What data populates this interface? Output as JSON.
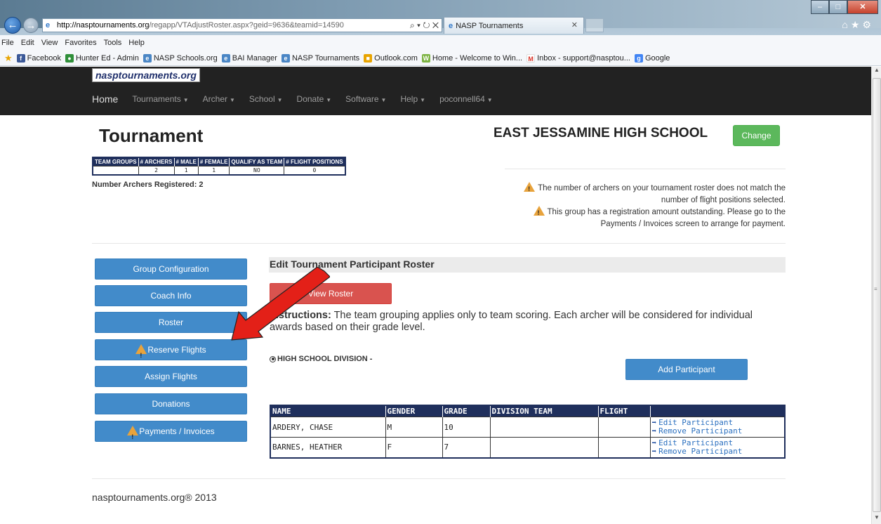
{
  "browser": {
    "url_domain": "http://nasptournaments.org",
    "url_rest": "/regapp/VTAdjustRoster.aspx?geid=9636&teamid=14590",
    "address_tools": "⌕ ▾ ↻ ✕",
    "tab_title": "NASP Tournaments",
    "menu": [
      "File",
      "Edit",
      "View",
      "Favorites",
      "Tools",
      "Help"
    ],
    "favorites": [
      {
        "label": "Facebook",
        "color": "#3b5998",
        "glyph": "f"
      },
      {
        "label": "Hunter Ed - Admin",
        "color": "#2f8f3a",
        "glyph": "●"
      },
      {
        "label": "NASP Schools.org",
        "color": "#4a86c5",
        "glyph": "e"
      },
      {
        "label": "BAI Manager",
        "color": "#4a86c5",
        "glyph": "e"
      },
      {
        "label": "NASP Tournaments",
        "color": "#4a86c5",
        "glyph": "e"
      },
      {
        "label": "Outlook.com",
        "color": "#e8a400",
        "glyph": "■"
      },
      {
        "label": "Home - Welcome to Win...",
        "color": "#7cb342",
        "glyph": "W"
      },
      {
        "label": "Inbox - support@nasptou...",
        "color": "#d93025",
        "glyph": "M"
      },
      {
        "label": "Google",
        "color": "#4285f4",
        "glyph": "g"
      }
    ]
  },
  "site": {
    "logo": "nasptournaments.org",
    "nav": [
      {
        "label": "Home",
        "caret": false
      },
      {
        "label": "Tournaments",
        "caret": true
      },
      {
        "label": "Archer",
        "caret": true
      },
      {
        "label": "School",
        "caret": true
      },
      {
        "label": "Donate",
        "caret": true
      },
      {
        "label": "Software",
        "caret": true
      },
      {
        "label": "Help",
        "caret": true
      },
      {
        "label": "poconnell64",
        "caret": true
      }
    ]
  },
  "header": {
    "title": "Tournament",
    "school": "EAST JESSAMINE HIGH SCHOOL",
    "change_label": "Change"
  },
  "summary": {
    "headers": [
      "TEAM GROUPS",
      "# ARCHERS",
      "# MALE",
      "# FEMALE",
      "QUALIFY AS TEAM",
      "# FLIGHT POSITIONS"
    ],
    "row": [
      "",
      "2",
      "1",
      "1",
      "NO",
      "0"
    ],
    "registered": "Number Archers Registered: 2"
  },
  "warnings": [
    "The number of archers on your tournament roster does not match the number of flight positions selected.",
    "This group has a registration amount outstanding. Please go to the Payments / Invoices screen to arrange for payment."
  ],
  "sidebar": [
    {
      "label": "Group Configuration",
      "warn": false
    },
    {
      "label": "Coach Info",
      "warn": false
    },
    {
      "label": "Roster",
      "warn": false
    },
    {
      "label": "Reserve Flights",
      "warn": true
    },
    {
      "label": "Assign Flights",
      "warn": false
    },
    {
      "label": "Donations",
      "warn": false
    },
    {
      "label": "Payments / Invoices",
      "warn": true
    }
  ],
  "main": {
    "section_title": "Edit Tournament Participant Roster",
    "view_roster_label": "View Roster",
    "instructions_bold": "Instructions:",
    "instructions_text": " The team grouping applies only to team scoring. Each archer will be considered for individual awards based on their grade level.",
    "division": "HIGH SCHOOL DIVISION -",
    "add_participant_label": "Add Participant"
  },
  "roster": {
    "headers": [
      "NAME",
      "GENDER",
      "GRADE",
      "DIVISION TEAM",
      "FLIGHT",
      ""
    ],
    "rows": [
      {
        "name": "ARDERY, CHASE",
        "gender": "M",
        "grade": "10",
        "team": "",
        "flight": ""
      },
      {
        "name": "BARNES, HEATHER",
        "gender": "F",
        "grade": "7",
        "team": "",
        "flight": ""
      }
    ],
    "edit_label": "Edit Participant",
    "remove_label": "Remove Participant"
  },
  "footer": "nasptournaments.org® 2013"
}
